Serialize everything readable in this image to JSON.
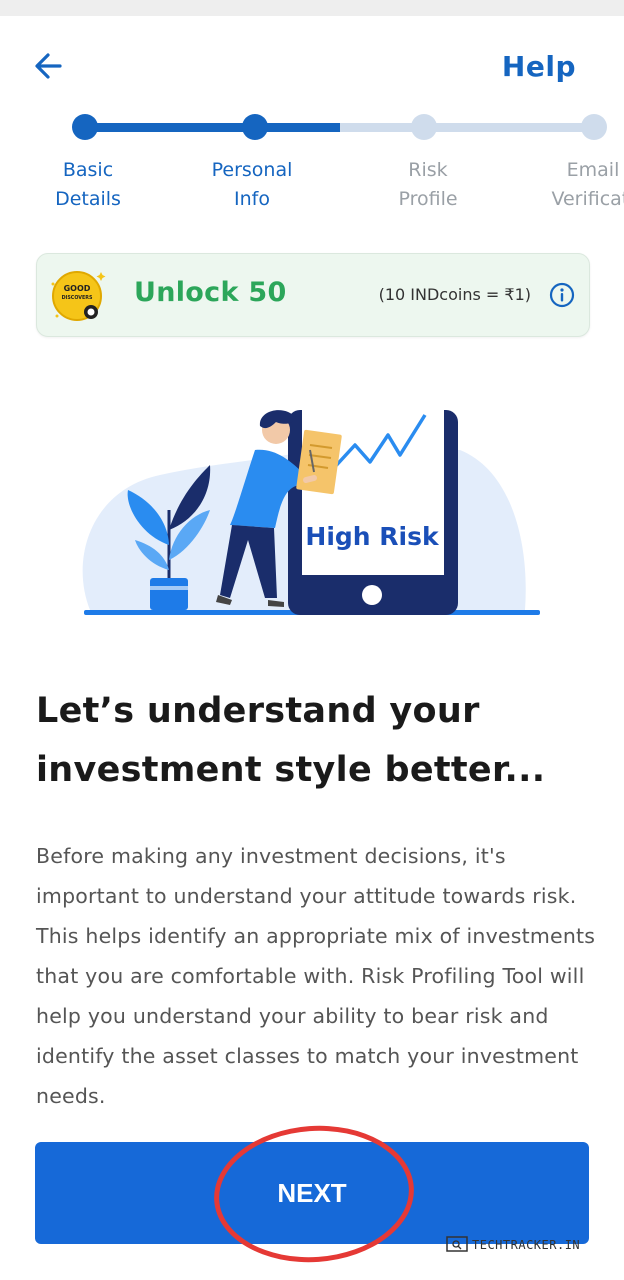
{
  "header": {
    "help_label": "Help"
  },
  "stepper": {
    "steps": [
      {
        "label": "Basic\nDetails",
        "state": "done"
      },
      {
        "label": "Personal\nInfo",
        "state": "current"
      },
      {
        "label": "Risk\nProfile",
        "state": "pending"
      },
      {
        "label": "Email\nVerificati",
        "state": "pending"
      }
    ]
  },
  "reward": {
    "coin_text_top": "GOOD",
    "coin_text_mid": "DISCOVERS",
    "unlock_label": "Unlock 50",
    "rate_label": "(10 INDcoins = ₹1)"
  },
  "illustration": {
    "caption": "High Risk"
  },
  "content": {
    "heading": "Let’s understand your\ninvestment style better...",
    "paragraph": "Before making any investment decisions, it's important to understand your attitude towards risk. This helps identify an appropriate mix of investments that you are comfortable with. Risk Profiling Tool will help you understand your ability to bear risk and identify the asset classes to match your investment needs."
  },
  "footer": {
    "next_label": "NEXT"
  },
  "watermark": {
    "text": "TECHTRACKER.IN"
  },
  "colors": {
    "primary": "#1669d8",
    "accent_text": "#1565c0",
    "success": "#2ca65a",
    "pending": "#cfdcec",
    "annotation": "#e53935"
  }
}
